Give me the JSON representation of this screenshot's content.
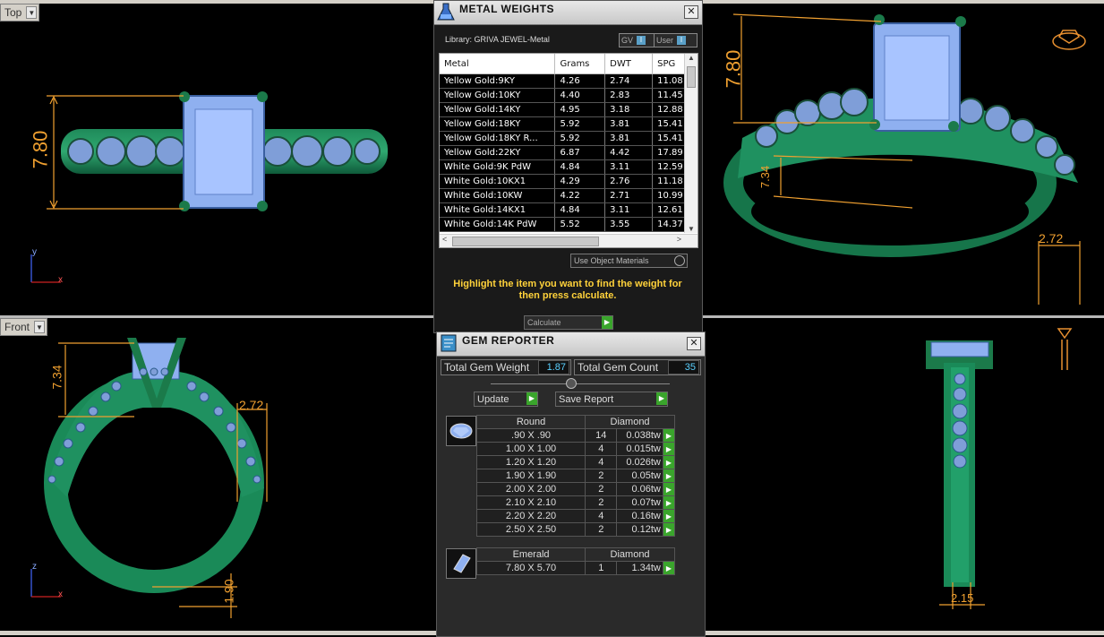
{
  "viewports": {
    "top": {
      "label": "Top",
      "dim_height": "7.80",
      "axis_y": "y",
      "axis_x": "x"
    },
    "perspective": {
      "dim_height": "7.80",
      "dim_side": "7.34",
      "dim_width": "2.72"
    },
    "front": {
      "label": "Front",
      "dim_height": "7.34",
      "dim_width": "2.72",
      "dim_bottom": "1.90",
      "axis_y": "z",
      "axis_x": "x"
    },
    "right": {
      "dim_bottom": "2.15"
    }
  },
  "metal_weights": {
    "title": "METAL WEIGHTS",
    "library": "Library: GRIVA JEWEL-Metal",
    "toggle_gv": "GV",
    "toggle_user": "User",
    "columns": [
      "Metal",
      "Grams",
      "DWT",
      "SPG"
    ],
    "rows": [
      [
        "Yellow Gold:9KY",
        "4.26",
        "2.74",
        "11.08"
      ],
      [
        "Yellow Gold:10KY",
        "4.40",
        "2.83",
        "11.45"
      ],
      [
        "Yellow Gold:14KY",
        "4.95",
        "3.18",
        "12.88"
      ],
      [
        "Yellow Gold:18KY",
        "5.92",
        "3.81",
        "15.41"
      ],
      [
        "Yellow Gold:18KY R...",
        "5.92",
        "3.81",
        "15.41"
      ],
      [
        "Yellow Gold:22KY",
        "6.87",
        "4.42",
        "17.89"
      ],
      [
        "White Gold:9K PdW",
        "4.84",
        "3.11",
        "12.59"
      ],
      [
        "White Gold:10KX1",
        "4.29",
        "2.76",
        "11.18"
      ],
      [
        "White Gold:10KW",
        "4.22",
        "2.71",
        "10.99"
      ],
      [
        "White Gold:14KX1",
        "4.84",
        "3.11",
        "12.61"
      ],
      [
        "White Gold:14K PdW",
        "5.52",
        "3.55",
        "14.37"
      ]
    ],
    "use_object_materials": "Use Object Materials",
    "hint": "Highlight the item you want to find the weight for then press calculate.",
    "calculate": "Calculate"
  },
  "gem_reporter": {
    "title": "GEM REPORTER",
    "total_weight_label": "Total Gem Weight",
    "total_weight": "1.87",
    "total_count_label": "Total Gem Count",
    "total_count": "35",
    "update": "Update",
    "save_report": "Save Report",
    "groups": [
      {
        "shape": "Round",
        "material": "Diamond",
        "rows": [
          [
            ".90 X .90",
            "14",
            "0.038tw"
          ],
          [
            "1.00 X 1.00",
            "4",
            "0.015tw"
          ],
          [
            "1.20 X 1.20",
            "4",
            "0.026tw"
          ],
          [
            "1.90 X 1.90",
            "2",
            "0.05tw"
          ],
          [
            "2.00 X 2.00",
            "2",
            "0.06tw"
          ],
          [
            "2.10 X 2.10",
            "2",
            "0.07tw"
          ],
          [
            "2.20 X 2.20",
            "4",
            "0.16tw"
          ],
          [
            "2.50 X 2.50",
            "2",
            "0.12tw"
          ]
        ]
      },
      {
        "shape": "Emerald",
        "material": "Diamond",
        "rows": [
          [
            "7.80 X 5.70",
            "1",
            "1.34tw"
          ]
        ]
      }
    ]
  }
}
